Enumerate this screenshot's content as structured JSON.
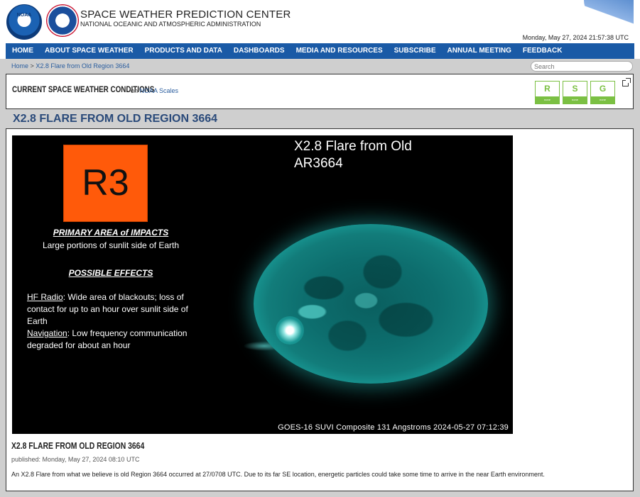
{
  "header": {
    "title": "SPACE WEATHER PREDICTION CENTER",
    "subtitle": "NATIONAL OCEANIC AND ATMOSPHERIC ADMINISTRATION",
    "noaa_logo_text": "NOAA",
    "datetime": "Monday, May 27, 2024 21:57:38 UTC"
  },
  "nav": {
    "items": [
      "HOME",
      "ABOUT SPACE WEATHER",
      "PRODUCTS AND DATA",
      "DASHBOARDS",
      "MEDIA AND RESOURCES",
      "SUBSCRIBE",
      "ANNUAL MEETING",
      "FEEDBACK"
    ]
  },
  "breadcrumb": {
    "home": "Home",
    "separator": ">",
    "current": "X2.8 Flare from Old Region 3664"
  },
  "search": {
    "placeholder": "Search"
  },
  "conditions": {
    "title": "CURRENT SPACE WEATHER CONDITIONS",
    "on_text": "on",
    "scales_link": "NOAA Scales",
    "scales": [
      {
        "letter": "R",
        "status": "none"
      },
      {
        "letter": "S",
        "status": "none"
      },
      {
        "letter": "G",
        "status": "none"
      }
    ],
    "scale_color": "#7bc043"
  },
  "page_heading": "X2.8 FLARE FROM OLD REGION 3664",
  "image": {
    "badge": "R3",
    "badge_color": "#ff5a0a",
    "impact_title": "PRIMARY AREA of IMPACTS",
    "impact_text": "Large portions of sunlit side of Earth",
    "effects_title": "POSSIBLE EFFECTS",
    "hf_label": "HF Radio",
    "hf_text": ": Wide area of blackouts; loss of contact for up to an hour over sunlit side of Earth",
    "nav_label": "Navigation",
    "nav_text": ": Low frequency communication degraded for about an hour",
    "flare_title_line1": "X2.8 Flare from Old",
    "flare_title_line2": "AR3664",
    "caption": "GOES-16 SUVI Composite 131 Angstroms 2024-05-27 07:12:39"
  },
  "article": {
    "title": "X2.8 FLARE FROM OLD REGION 3664",
    "published": "published: Monday, May 27, 2024 08:10 UTC",
    "body": "An X2.8 Flare from what we believe is old Region 3664 occurred at 27/0708 UTC. Due to its far SE location, energetic particles could take some time to arrive in the near Earth environment."
  }
}
